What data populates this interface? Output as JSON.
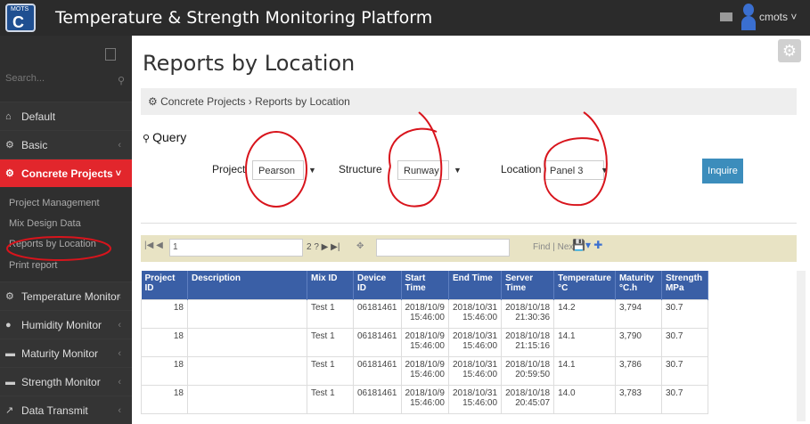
{
  "header": {
    "logo_small": "MOTS",
    "logo_letter": "C",
    "title": "Temperature & Strength Monitoring Platform",
    "user": "cmots ˅"
  },
  "sidebar": {
    "search_placeholder": "Search...",
    "items": [
      {
        "label": "Default",
        "icon": "home-icon"
      },
      {
        "label": "Basic",
        "icon": "cogs-icon"
      },
      {
        "label": "Concrete Projects",
        "icon": "cogs-icon"
      },
      {
        "label": "Temperature Monitor",
        "icon": "cogs-icon"
      },
      {
        "label": "Humidity Monitor",
        "icon": "tint-icon"
      },
      {
        "label": "Maturity Monitor",
        "icon": "chart-icon"
      },
      {
        "label": "Strength Monitor",
        "icon": "chart-icon"
      },
      {
        "label": "Data Transmit",
        "icon": "share-icon"
      }
    ],
    "subitems": [
      "Project Management",
      "Mix Design Data",
      "Reports by Location",
      "Print report"
    ]
  },
  "main": {
    "title": "Reports by Location",
    "breadcrumb": "Concrete Projects › Reports by Location",
    "query_title": "Query",
    "project_label": "Project",
    "project_value": "Pearson",
    "structure_label": "Structure",
    "structure_value": "Runway",
    "location_label": "Location",
    "location_value": "Panel 3",
    "inquire_label": "Inquire"
  },
  "grid": {
    "page_value": "1",
    "page_nav": "2 ?  ▶  ▶|",
    "find_label": "Find | Next",
    "columns": [
      "Project ID",
      "Description",
      "Mix ID",
      "Device ID",
      "Start Time",
      "End Time",
      "Server Time",
      "Temperature °C",
      "Maturity °C.h",
      "Strength MPa"
    ],
    "rows": [
      [
        "18",
        "",
        "Test 1",
        "06181461",
        "2018/10/9 15:46:00",
        "2018/10/31 15:46:00",
        "2018/10/18 21:30:36",
        "14.2",
        "3,794",
        "30.7"
      ],
      [
        "18",
        "",
        "Test 1",
        "06181461",
        "2018/10/9 15:46:00",
        "2018/10/31 15:46:00",
        "2018/10/18 21:15:16",
        "14.1",
        "3,790",
        "30.7"
      ],
      [
        "18",
        "",
        "Test 1",
        "06181461",
        "2018/10/9 15:46:00",
        "2018/10/31 15:46:00",
        "2018/10/18 20:59:50",
        "14.1",
        "3,786",
        "30.7"
      ],
      [
        "18",
        "",
        "Test 1",
        "06181461",
        "2018/10/9 15:46:00",
        "2018/10/31 15:46:00",
        "2018/10/18 20:45:07",
        "14.0",
        "3,783",
        "30.7"
      ]
    ]
  },
  "colors": {
    "accent": "#e2262c",
    "header_blue": "#3a5fa6",
    "button_blue": "#3c8dbc"
  }
}
